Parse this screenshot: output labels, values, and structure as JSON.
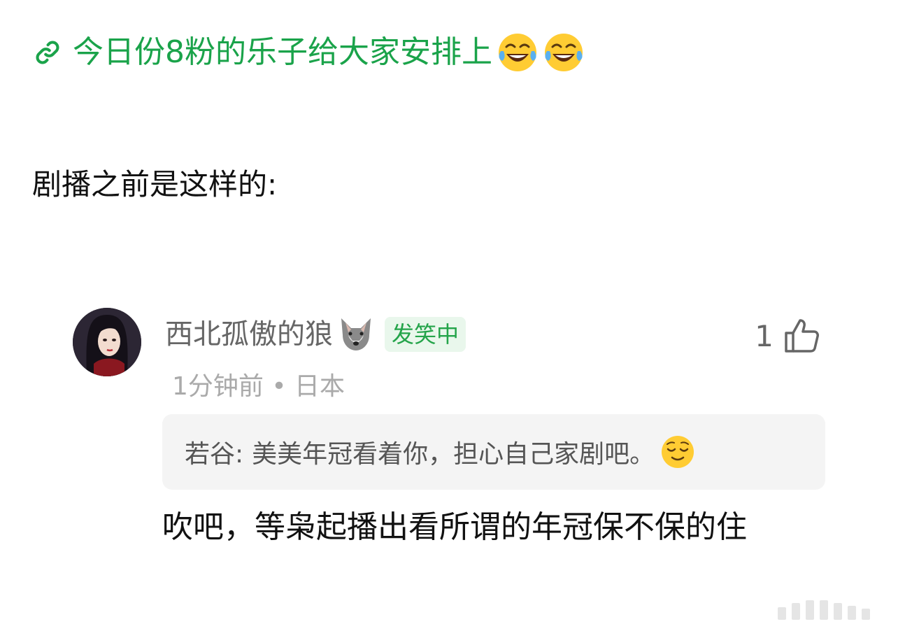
{
  "post": {
    "link_text": "今日份8粉的乐子给大家安排上",
    "emojis": [
      "laughing-tears-emoji",
      "laughing-tears-emoji"
    ],
    "link_color": "#1aa34a"
  },
  "intro": {
    "text": "剧播之前是这样的:"
  },
  "comment": {
    "username": "西北孤傲的狼",
    "username_icon": "wolf-emoji",
    "badge": "发笑中",
    "badge_color": "#24a44a",
    "likes": "1",
    "like_icon": "thumbs-up-icon",
    "meta": "1分钟前 • 日本",
    "quote": {
      "author": "若谷:",
      "text": "美美年冠看着你，担心自己家剧吧。",
      "emoji": "relieved-face-emoji"
    },
    "reply": "吹吧，等枭起播出看所谓的年冠保不保的住"
  }
}
